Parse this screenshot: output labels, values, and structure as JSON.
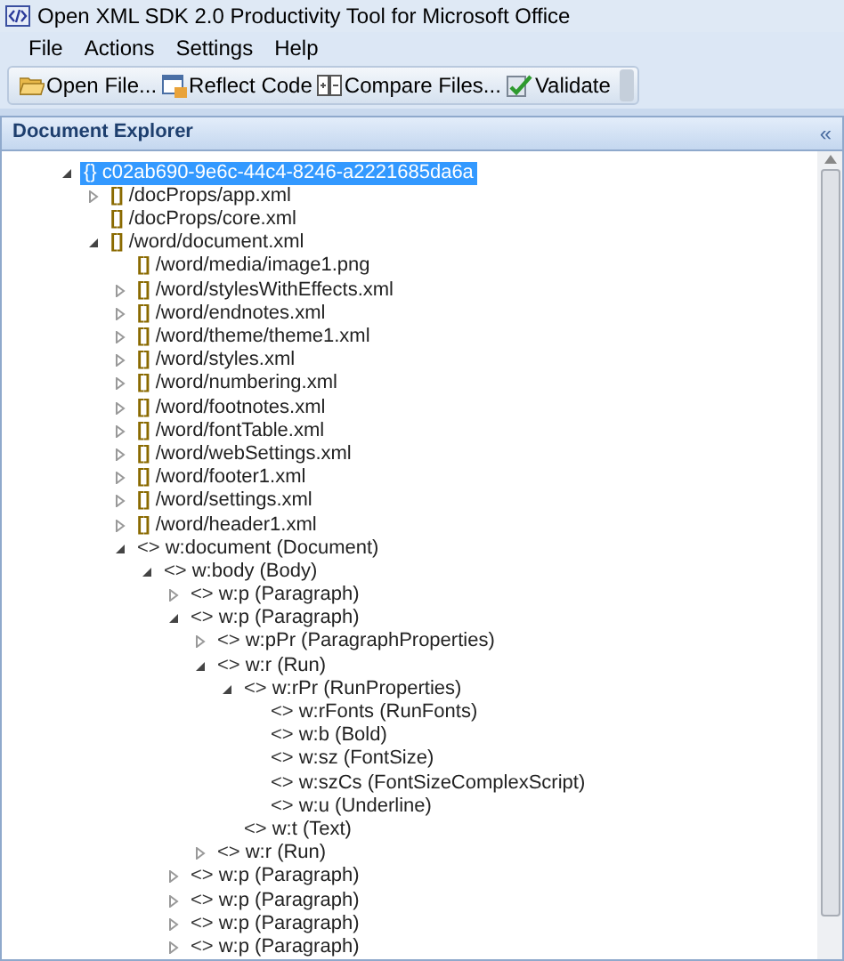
{
  "window": {
    "title": "Open XML SDK 2.0 Productivity Tool for Microsoft Office"
  },
  "menu": [
    "File",
    "Actions",
    "Settings",
    "Help"
  ],
  "toolbar": [
    {
      "kind": "open",
      "label": "Open File..."
    },
    {
      "kind": "reflect",
      "label": "Reflect Code"
    },
    {
      "kind": "compare",
      "label": "Compare Files..."
    },
    {
      "kind": "validate",
      "label": "Validate"
    }
  ],
  "panel": {
    "title": "Document Explorer",
    "collapse": "«"
  },
  "tree": [
    {
      "icon": "{}",
      "label": "c02ab690-9e6c-44c4-8246-a2221685da6a",
      "selected": true,
      "expanded": true,
      "children": [
        {
          "icon": "[]",
          "label": "/docProps/app.xml",
          "selected": false,
          "expanded": false
        },
        {
          "icon": "[]",
          "label": "/docProps/core.xml",
          "selected": false
        },
        {
          "icon": "[]",
          "label": "/word/document.xml",
          "selected": false,
          "expanded": true,
          "children": [
            {
              "icon": "[]",
              "label": "/word/media/image1.png",
              "selected": false
            },
            {
              "icon": "[]",
              "label": "/word/stylesWithEffects.xml",
              "selected": false,
              "expanded": false
            },
            {
              "icon": "[]",
              "label": "/word/endnotes.xml",
              "selected": false,
              "expanded": false
            },
            {
              "icon": "[]",
              "label": "/word/theme/theme1.xml",
              "selected": false,
              "expanded": false
            },
            {
              "icon": "[]",
              "label": "/word/styles.xml",
              "selected": false,
              "expanded": false
            },
            {
              "icon": "[]",
              "label": "/word/numbering.xml",
              "selected": false,
              "expanded": false
            },
            {
              "icon": "[]",
              "label": "/word/footnotes.xml",
              "selected": false,
              "expanded": false
            },
            {
              "icon": "[]",
              "label": "/word/fontTable.xml",
              "selected": false,
              "expanded": false
            },
            {
              "icon": "[]",
              "label": "/word/webSettings.xml",
              "selected": false,
              "expanded": false
            },
            {
              "icon": "[]",
              "label": "/word/footer1.xml",
              "selected": false,
              "expanded": false
            },
            {
              "icon": "[]",
              "label": "/word/settings.xml",
              "selected": false,
              "expanded": false
            },
            {
              "icon": "[]",
              "label": "/word/header1.xml",
              "selected": false,
              "expanded": false
            },
            {
              "icon": "<>",
              "label": "w:document (Document)",
              "selected": false,
              "expanded": true,
              "children": [
                {
                  "icon": "<>",
                  "label": "w:body (Body)",
                  "selected": false,
                  "expanded": true,
                  "children": [
                    {
                      "icon": "<>",
                      "label": "w:p (Paragraph)",
                      "selected": false,
                      "expanded": false
                    },
                    {
                      "icon": "<>",
                      "label": "w:p (Paragraph)",
                      "selected": false,
                      "expanded": true,
                      "children": [
                        {
                          "icon": "<>",
                          "label": "w:pPr (ParagraphProperties)",
                          "selected": false,
                          "expanded": false
                        },
                        {
                          "icon": "<>",
                          "label": "w:r (Run)",
                          "selected": false,
                          "expanded": true,
                          "children": [
                            {
                              "icon": "<>",
                              "label": "w:rPr (RunProperties)",
                              "selected": false,
                              "expanded": true,
                              "children": [
                                {
                                  "icon": "<>",
                                  "label": "w:rFonts (RunFonts)",
                                  "selected": false
                                },
                                {
                                  "icon": "<>",
                                  "label": "w:b (Bold)",
                                  "selected": false
                                },
                                {
                                  "icon": "<>",
                                  "label": "w:sz (FontSize)",
                                  "selected": false
                                },
                                {
                                  "icon": "<>",
                                  "label": "w:szCs (FontSizeComplexScript)",
                                  "selected": false
                                },
                                {
                                  "icon": "<>",
                                  "label": "w:u (Underline)",
                                  "selected": false
                                }
                              ]
                            },
                            {
                              "icon": "<>",
                              "label": "w:t (Text)",
                              "selected": false
                            }
                          ]
                        },
                        {
                          "icon": "<>",
                          "label": "w:r (Run)",
                          "selected": false,
                          "expanded": false
                        }
                      ]
                    },
                    {
                      "icon": "<>",
                      "label": "w:p (Paragraph)",
                      "selected": false,
                      "expanded": false
                    },
                    {
                      "icon": "<>",
                      "label": "w:p (Paragraph)",
                      "selected": false,
                      "expanded": false
                    },
                    {
                      "icon": "<>",
                      "label": "w:p (Paragraph)",
                      "selected": false,
                      "expanded": false
                    },
                    {
                      "icon": "<>",
                      "label": "w:p (Paragraph)",
                      "selected": false,
                      "expanded": false
                    }
                  ]
                }
              ]
            }
          ]
        }
      ]
    }
  ]
}
